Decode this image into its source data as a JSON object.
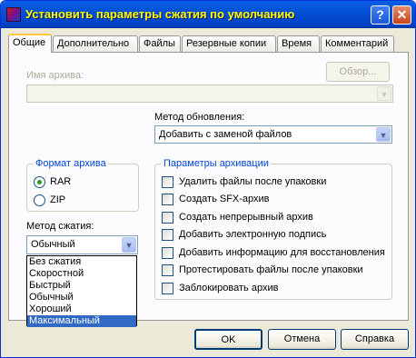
{
  "window": {
    "title": "Установить параметры сжатия по умолчанию",
    "help_button": "?",
    "close_button": "✕"
  },
  "tabs": [
    "Общие",
    "Дополнительно",
    "Файлы",
    "Резервные копии",
    "Время",
    "Комментарий"
  ],
  "archive_name": {
    "label": "Имя архива:",
    "browse_button": "Обзор...",
    "value": ""
  },
  "update_method": {
    "label": "Метод обновления:",
    "value": "Добавить с заменой файлов"
  },
  "archive_format": {
    "legend": "Формат архива",
    "options": [
      "RAR",
      "ZIP"
    ],
    "selected": "RAR"
  },
  "compression_method": {
    "label": "Метод сжатия:",
    "value": "Обычный",
    "options": [
      "Без сжатия",
      "Скоростной",
      "Быстрый",
      "Обычный",
      "Хороший",
      "Максимальный"
    ],
    "highlighted": "Максимальный"
  },
  "archive_params": {
    "legend": "Параметры архивации",
    "options": [
      {
        "label": "Удалить файлы после упаковки",
        "checked": false
      },
      {
        "label": "Создать SFX-архив",
        "checked": false
      },
      {
        "label": "Создать непрерывный архив",
        "checked": false
      },
      {
        "label": "Добавить электронную подпись",
        "checked": false
      },
      {
        "label": "Добавить информацию для восстановления",
        "checked": false
      },
      {
        "label": "Протестировать файлы после упаковки",
        "checked": false
      },
      {
        "label": "Заблокировать архив",
        "checked": false
      }
    ]
  },
  "buttons": {
    "ok": "OK",
    "cancel": "Отмена",
    "help": "Справка"
  },
  "icons": {
    "app": "winrar-icon",
    "dropdown": "chevron-down-icon"
  },
  "colors": {
    "title_text": "#ffff00",
    "title_bar": "#0550d4",
    "group_legend": "#0046d5",
    "selection": "#316ac5"
  }
}
